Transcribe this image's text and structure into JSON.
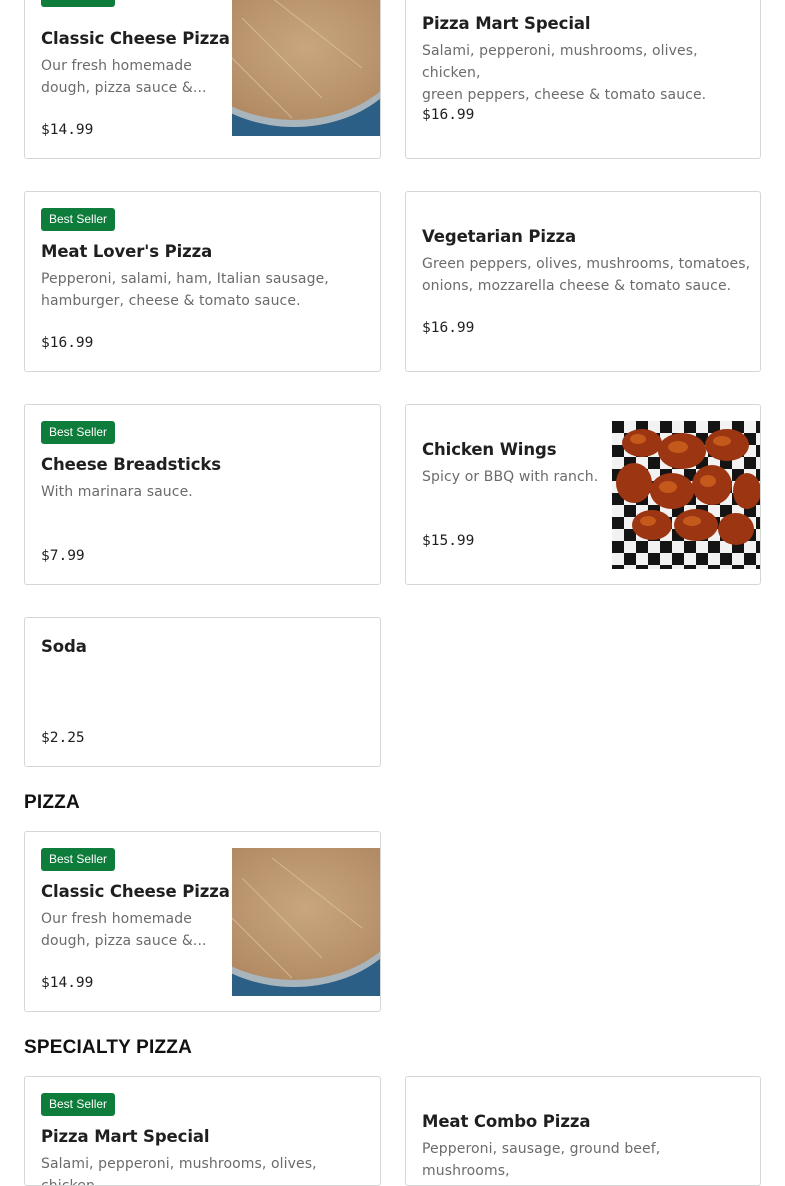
{
  "badge_label": "Best Seller",
  "colors": {
    "badge": "#0e7c3a",
    "border": "#d6d6d6"
  },
  "featured": {
    "items": [
      {
        "title": "Classic Cheese Pizza",
        "description_lines": [
          "Our fresh homemade",
          "dough, pizza sauce &..."
        ],
        "price": "$14.99",
        "image": "cheese-pizza-photo"
      },
      {
        "title": "Pizza Mart Special",
        "description_lines": [
          "Salami, pepperoni, mushrooms, olives, chicken,",
          "green peppers, cheese & tomato sauce."
        ],
        "price": "$16.99"
      },
      {
        "title": "Meat Lover's Pizza",
        "description_lines": [
          "Pepperoni, salami, ham, Italian sausage,",
          "hamburger, cheese & tomato sauce."
        ],
        "price": "$16.99"
      },
      {
        "title": "Vegetarian Pizza",
        "description_lines": [
          "Green peppers, olives, mushrooms, tomatoes,",
          "onions, mozzarella cheese & tomato sauce."
        ],
        "price": "$16.99"
      },
      {
        "title": "Cheese Breadsticks",
        "description_lines": [
          "With marinara sauce."
        ],
        "price": "$7.99"
      },
      {
        "title": "Chicken Wings",
        "description_lines": [
          "Spicy or BBQ with ranch."
        ],
        "price": "$15.99",
        "image": "chicken-wings-photo"
      },
      {
        "title": "Soda",
        "price": "$2.25"
      }
    ]
  },
  "pizza": {
    "heading": "PIZZA",
    "items": [
      {
        "title": "Classic Cheese Pizza",
        "description_lines": [
          "Our fresh homemade",
          "dough, pizza sauce &..."
        ],
        "price": "$14.99",
        "image": "cheese-pizza-photo"
      }
    ]
  },
  "specialty": {
    "heading": "SPECIALTY PIZZA",
    "items": [
      {
        "title": "Pizza Mart Special",
        "description_lines": [
          "Salami, pepperoni, mushrooms, olives, chicken,"
        ]
      },
      {
        "title": "Meat Combo Pizza",
        "description_lines": [
          "Pepperoni, sausage, ground beef, mushrooms,"
        ]
      }
    ]
  }
}
